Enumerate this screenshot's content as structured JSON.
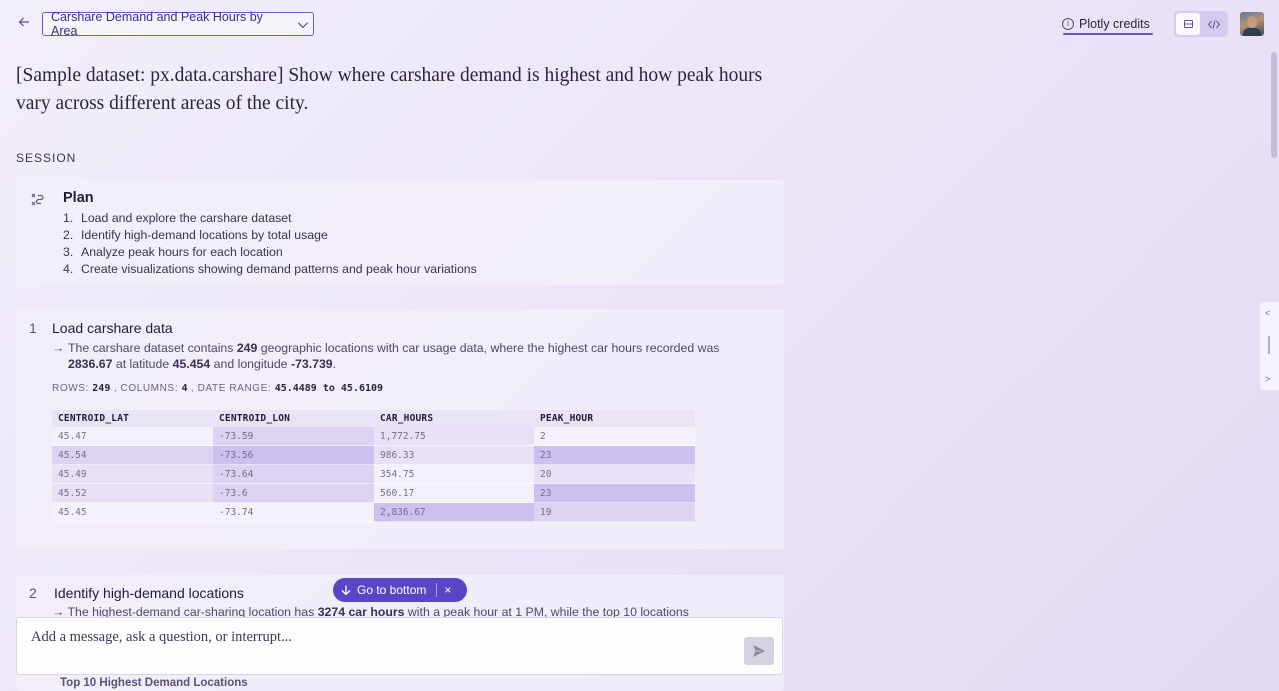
{
  "header": {
    "back_icon": "arrow-left-icon",
    "title": "Carshare Demand and Peak Hours by Area",
    "credits_label": "Plotly credits",
    "view_toggle": [
      "list-view-icon",
      "code-view-icon"
    ]
  },
  "prompt": "[Sample dataset: px.data.carshare] Show where carshare demand is highest and how peak hours vary across different areas of the city.",
  "session_label": "SESSION",
  "plan": {
    "title": "Plan",
    "items": [
      "Load and explore the carshare dataset",
      "Identify high-demand locations by total usage",
      "Analyze peak hours for each location",
      "Create visualizations showing demand patterns and peak hour variations"
    ]
  },
  "step1": {
    "number": "1",
    "title": "Load carshare data",
    "arrow": "→",
    "text_parts": [
      "The carshare dataset contains ",
      "249",
      " geographic locations with car usage data, where the highest car hours recorded was ",
      "2836.67",
      " at latitude ",
      "45.454",
      " and longitude ",
      "-73.739",
      "."
    ],
    "meta": {
      "rows_label": "ROWS:",
      "rows": "249",
      "columns_label": ", COLUMNS:",
      "columns": "4",
      "range_label": ", DATE RANGE:",
      "range": "45.4489 to 45.6109"
    },
    "table": {
      "columns": [
        "CENTROID_LAT",
        "CENTROID_LON",
        "CAR_HOURS",
        "PEAK_HOUR"
      ],
      "rows": [
        [
          "45.47",
          "-73.59",
          "1,772.75",
          "2"
        ],
        [
          "45.54",
          "-73.56",
          "986.33",
          "23"
        ],
        [
          "45.49",
          "-73.64",
          "354.75",
          "20"
        ],
        [
          "45.52",
          "-73.6",
          "560.17",
          "23"
        ],
        [
          "45.45",
          "-73.74",
          "2,836.67",
          "19"
        ]
      ],
      "shades": [
        [
          "s0",
          "s2",
          "s1",
          "s0"
        ],
        [
          "s2",
          "s3",
          "s1",
          "s3"
        ],
        [
          "s1",
          "s2",
          "s0",
          "s1"
        ],
        [
          "s1",
          "s2",
          "s0",
          "s3"
        ],
        [
          "s0",
          "s0",
          "s3",
          "s2"
        ]
      ]
    }
  },
  "step2": {
    "number": "2",
    "title": "Identify high-demand locations",
    "arrow": "→",
    "text_parts": [
      "The highest-demand car-sharing location has ",
      "3274 car hours",
      " with a peak hour at 1 PM, while the top 10 locations"
    ],
    "chart_caption": "Top 10 Highest Demand Locations"
  },
  "go_bottom": {
    "label": "Go to bottom",
    "close": "×"
  },
  "composer": {
    "placeholder": "Add a message, ask a question, or interrupt..."
  }
}
